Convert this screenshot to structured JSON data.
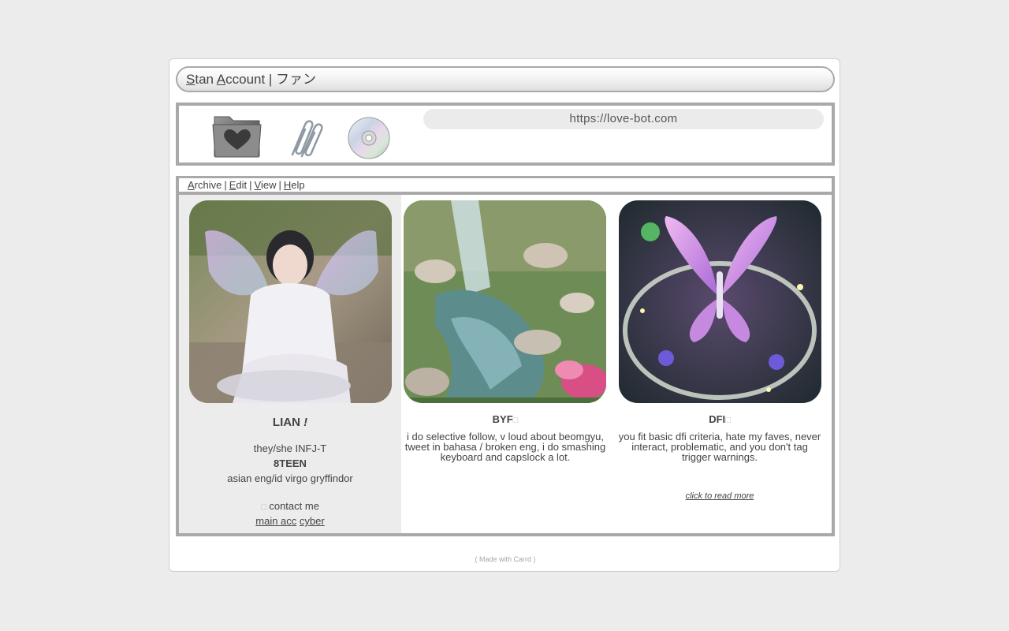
{
  "window": {
    "title_parts": [
      "S",
      "tan ",
      "A",
      "ccount | ファン"
    ]
  },
  "toolbar": {
    "icons": [
      "heart-folder-icon",
      "paperclip-icon",
      "cd-icon"
    ],
    "url": "https://love-bot.com"
  },
  "menu": {
    "items": [
      {
        "key": "A",
        "rest": "rchive"
      },
      {
        "key": "E",
        "rest": "dit"
      },
      {
        "key": "V",
        "rest": "iew"
      },
      {
        "key": "H",
        "rest": "elp"
      }
    ],
    "separator": "|"
  },
  "profile": {
    "name": "LIAN",
    "name_suffix": "!",
    "pronouns": "they/she INFJ-T",
    "age": "8TEEN",
    "info": "asian eng/id virgo gryffindor",
    "contact_icon": "□",
    "contact": "contact me",
    "links": [
      "main acc",
      "cyber"
    ]
  },
  "byf": {
    "title": "BYF",
    "title_glyph": "□",
    "text": "i do selective follow, v loud about beomgyu, tweet in bahasa / broken eng, i do smashing keyboard and capslock a lot."
  },
  "dfi": {
    "title": "DFI",
    "title_glyph": "□",
    "text": "you fit basic dfi criteria, hate my faves, never interact, problematic, and you don't tag trigger warnings.",
    "read_more": "click to read more"
  },
  "footer": {
    "text": "( Made with Carrd )"
  },
  "colors": {
    "page_bg": "#ececec",
    "frame_border": "#a9a9a9",
    "url_bg": "#ebebeb",
    "text": "#444444"
  }
}
